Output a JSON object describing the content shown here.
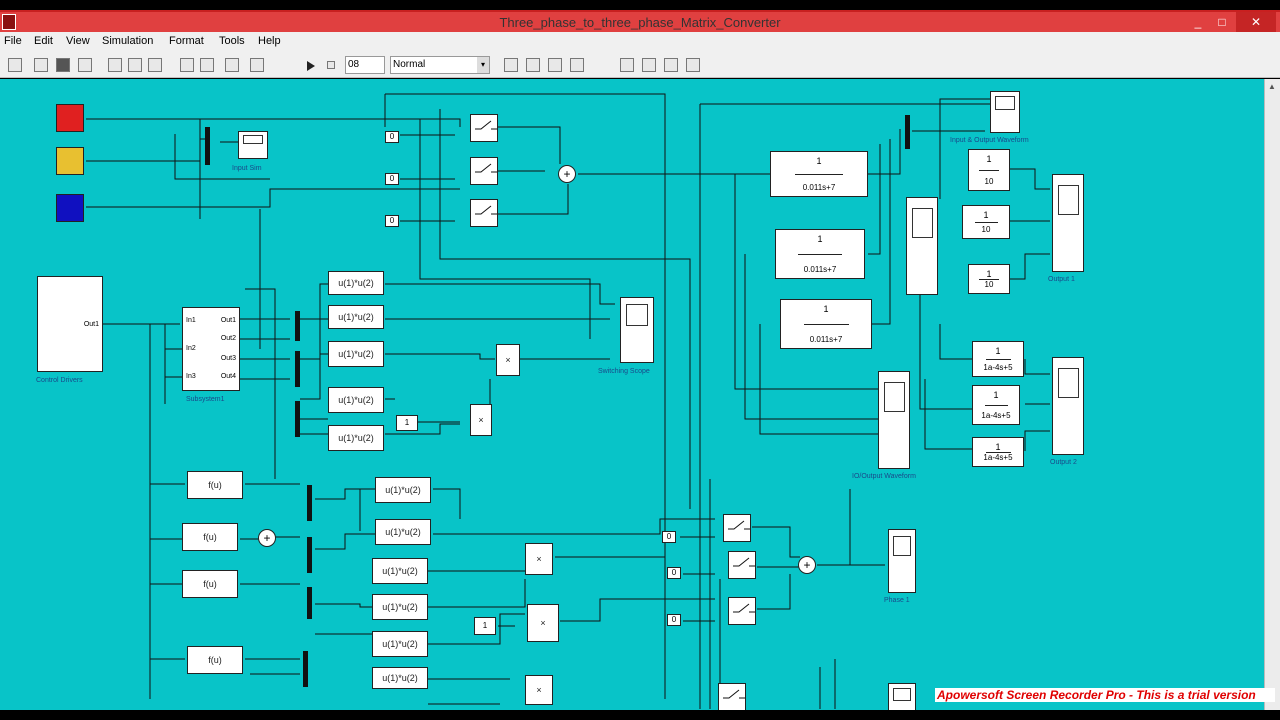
{
  "window": {
    "title": "Three_phase_to_three_phase_Matrix_Converter",
    "min_symbol": "_",
    "max_symbol": "□",
    "close_symbol": "✕"
  },
  "menu": [
    "File",
    "Edit",
    "View",
    "Simulation",
    "Format",
    "Tools",
    "Help"
  ],
  "toolbar": {
    "stop_time": "08",
    "sim_mode": "Normal",
    "dropdown_arrow": "▾"
  },
  "blocks": {
    "product": "×",
    "one": "1",
    "zero": "0",
    "fcn_u1u2": "u(1)*u(2)",
    "fcn_fu": "f(u)",
    "tf_num": "1",
    "tf_a": "0.011s+7",
    "tf_b": "0.011s+7",
    "tf_c": "0.011s+7",
    "gain_den": "10",
    "tf_lc": "1a-4s+5",
    "in_ports": [
      "In1",
      "In2",
      "In3"
    ],
    "out_ports": [
      "Out1",
      "Out2",
      "Out3",
      "Out4"
    ],
    "control_out": "Out1",
    "control_caption": "Control Drivers",
    "subsystem_caption": "Subsystem1",
    "sum_symbol": "+"
  },
  "captions": {
    "scope_mixed": "Input Sim",
    "switching_scope": "Switching Scope",
    "input_output": "Input & Output Waveform",
    "output_scope": "Output 1",
    "output_scope2": "Output 2",
    "ioutput": "IO/Output Waveform",
    "phase": "Phase 1"
  },
  "watermark": "Apowersoft Screen Recorder Pro - This is a trial version",
  "colors": {
    "canvas": "#08c4c8",
    "title_bar": "#e04040",
    "source_red": "#e02020",
    "source_yellow": "#e8c030",
    "source_blue": "#1010c0"
  }
}
